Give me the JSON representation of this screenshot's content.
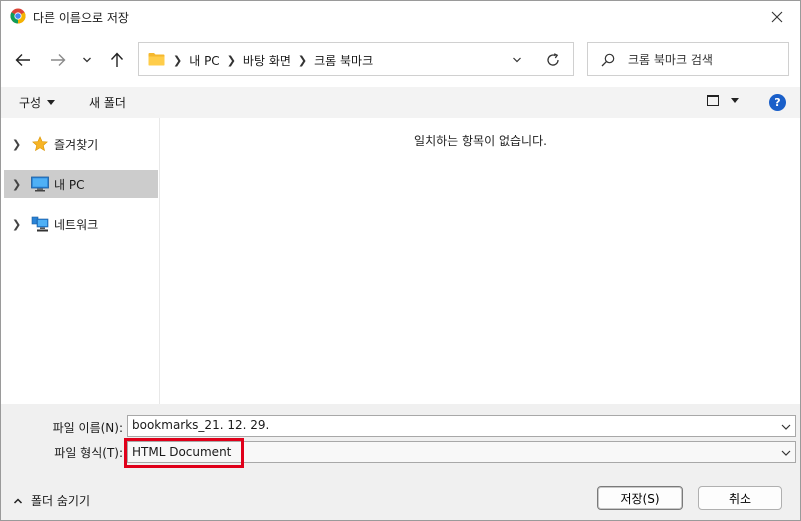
{
  "window": {
    "title": "다른 이름으로 저장"
  },
  "nav": {
    "breadcrumbs": [
      "내 PC",
      "바탕 화면",
      "크롬 북마크"
    ]
  },
  "search": {
    "placeholder": "크롬 북마크 검색"
  },
  "toolbar": {
    "organize_label": "구성",
    "new_folder_label": "새 폴더",
    "help_label": "?"
  },
  "sidebar": {
    "items": [
      {
        "label": "즐겨찾기",
        "icon": "star-icon"
      },
      {
        "label": "내 PC",
        "icon": "computer-icon",
        "selected": true
      },
      {
        "label": "네트워크",
        "icon": "network-icon"
      }
    ]
  },
  "content": {
    "empty_message": "일치하는 항목이 없습니다."
  },
  "form": {
    "filename_label": "파일 이름(N):",
    "filename_value": "bookmarks_21. 12. 29.",
    "filetype_label": "파일 형식(T):",
    "filetype_value": "HTML Document"
  },
  "footer": {
    "hide_folders_label": "폴더 숨기기",
    "save_label": "저장(S)",
    "cancel_label": "취소"
  },
  "colors": {
    "highlight": "#e0001a",
    "selected_bg": "#cccccc",
    "help_blue": "#1a5fc9"
  }
}
